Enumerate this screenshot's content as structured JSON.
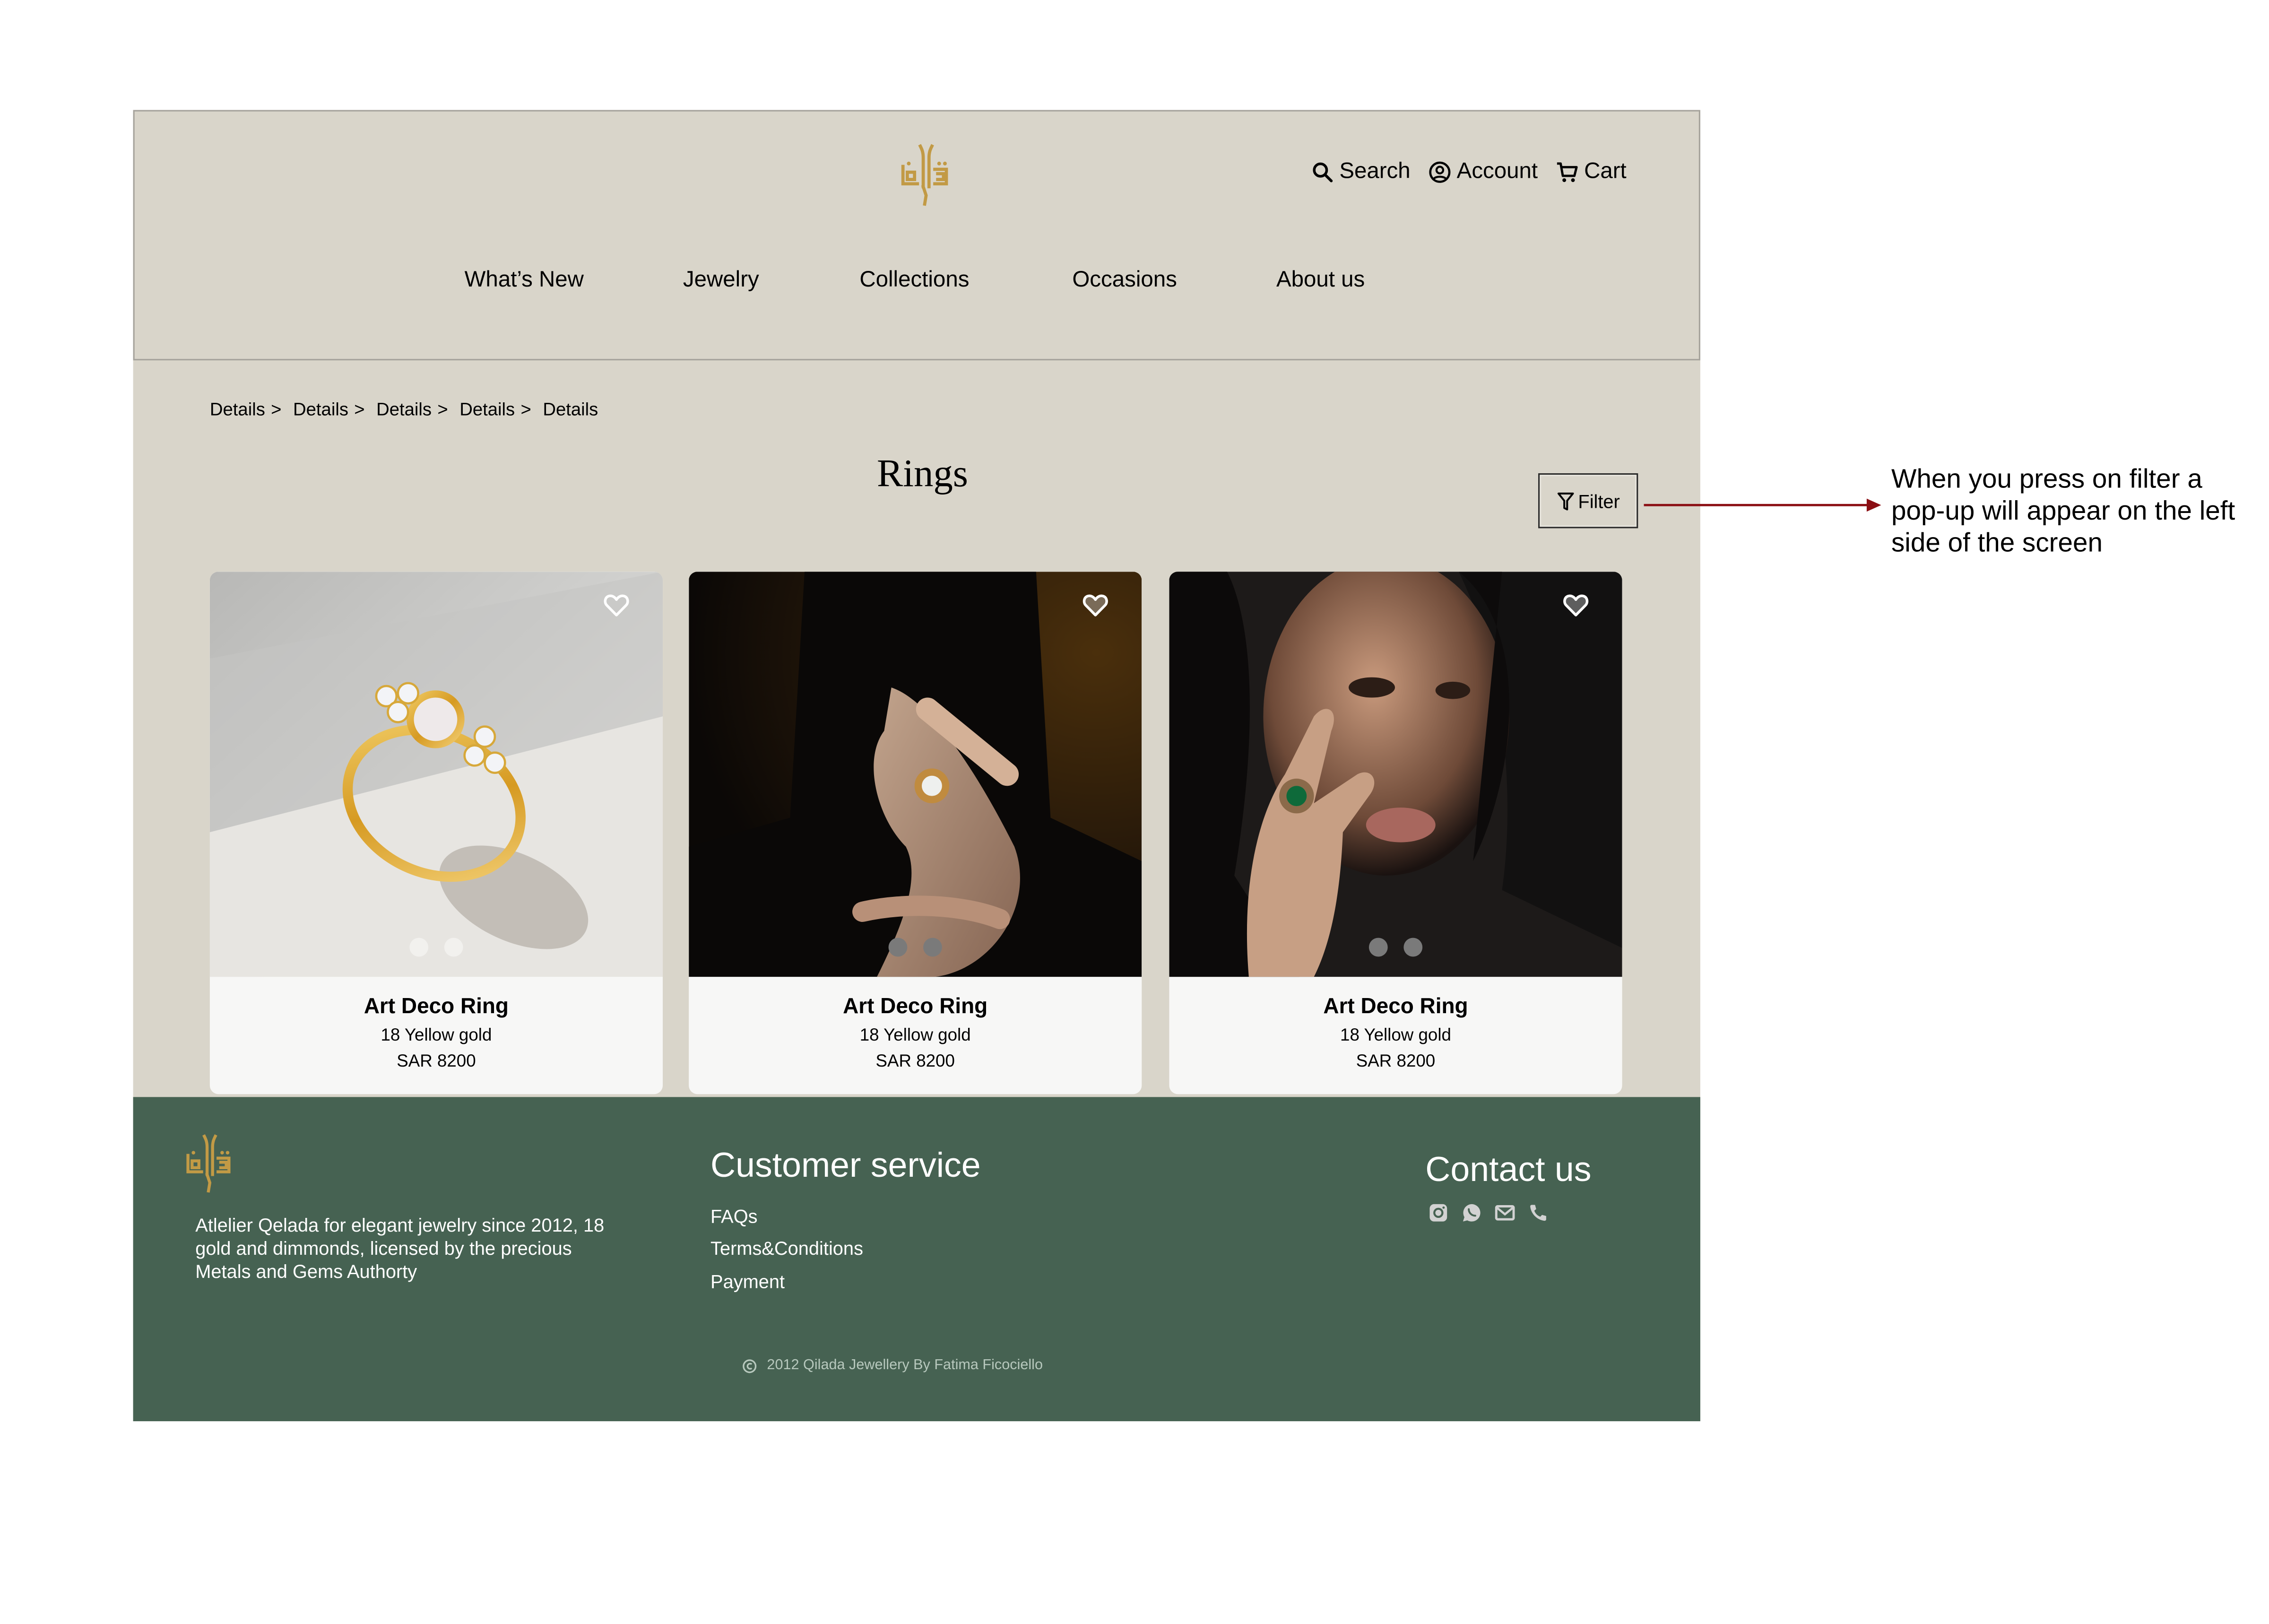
{
  "brand": {
    "logo_icon": "qilada-arabic-calligraphy-logo",
    "accent_color": "#c29a45",
    "page_background": "#d9d5ca",
    "footer_background": "#466252"
  },
  "header": {
    "actions": [
      {
        "label": "Search",
        "icon": "search-icon"
      },
      {
        "label": "Account",
        "icon": "account-circle-icon"
      },
      {
        "label": "Cart",
        "icon": "cart-icon"
      }
    ],
    "nav": [
      {
        "label": "What’s New"
      },
      {
        "label": "Jewelry"
      },
      {
        "label": "Collections"
      },
      {
        "label": "Occasions"
      },
      {
        "label": "About us"
      }
    ]
  },
  "breadcrumb": {
    "items": [
      "Details",
      "Details",
      "Details",
      "Details",
      "Details"
    ],
    "separator": ">"
  },
  "main": {
    "title": "Rings",
    "filter_label": "Filter",
    "filter_icon": "funnel-icon"
  },
  "products": [
    {
      "name": "Art Deco Ring",
      "material": "18 Yellow gold",
      "price": "SAR 8200",
      "image": "gold ring with mother-of-pearl stone on light grey background",
      "carousel_dots": 2,
      "favorite_icon": "heart-outline-icon"
    },
    {
      "name": "Art Deco Ring",
      "material": "18 Yellow gold",
      "price": "SAR 8200",
      "image": "hand wearing sunburst ring with pearl center, dark background",
      "carousel_dots": 2,
      "favorite_icon": "heart-outline-icon"
    },
    {
      "name": "Art Deco Ring",
      "material": "18 Yellow gold",
      "price": "SAR 8200",
      "image": "woman wearing sunburst ring with green malachite center",
      "carousel_dots": 2,
      "favorite_icon": "heart-outline-icon"
    }
  ],
  "footer": {
    "about": "Atlelier Qelada for elegant jewelry since 2012, 18  gold and dimmonds, licensed by the precious Metals and Gems Authorty",
    "customer_service": {
      "title": "Customer service",
      "links": [
        "FAQs",
        "Terms&Conditions",
        "Payment"
      ]
    },
    "contact": {
      "title": "Contact us",
      "icons": [
        "instagram-icon",
        "whatsapp-icon",
        "email-icon",
        "phone-icon"
      ]
    },
    "copyright": "2012 Qilada Jewellery By Fatima Ficociello"
  },
  "annotation": {
    "text": "When you press on filter a pop-up will appear on the left side of the screen",
    "arrow_color": "#8b0f14"
  }
}
